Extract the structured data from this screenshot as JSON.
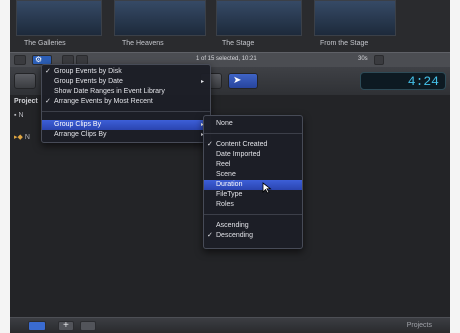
{
  "film_clips": [
    "The Galleries",
    "The Heavens",
    "The Stage",
    "From the Stage"
  ],
  "toolbar_top": {
    "selection_info": "1 of 15 selected, 10:21",
    "zoom": "30s"
  },
  "timecode": "4:24",
  "sidebar": {
    "heading": "Project",
    "row1": "N",
    "row2": "N"
  },
  "bottom": {
    "projects_label": "Projects"
  },
  "action_menu": {
    "items": [
      {
        "label": "Group Events by Disk",
        "checked": "✓"
      },
      {
        "label": "Group Events by Date",
        "checked": "",
        "submenu": "▸"
      },
      {
        "label": "Show Date Ranges in Event Library",
        "checked": ""
      },
      {
        "label": "Arrange Events by Most Recent",
        "checked": "✓"
      },
      {
        "label": "Group Clips By",
        "checked": "",
        "submenu": "▸"
      },
      {
        "label": "Arrange Clips By",
        "checked": "",
        "submenu": "▸"
      }
    ]
  },
  "group_clips_submenu": {
    "items": [
      {
        "label": "None",
        "checked": ""
      },
      {
        "label": "Content Created",
        "checked": "✓"
      },
      {
        "label": "Date Imported",
        "checked": ""
      },
      {
        "label": "Reel",
        "checked": ""
      },
      {
        "label": "Scene",
        "checked": ""
      },
      {
        "label": "Duration",
        "checked": ""
      },
      {
        "label": "FileType",
        "checked": ""
      },
      {
        "label": "Roles",
        "checked": ""
      },
      {
        "label": "Ascending",
        "checked": ""
      },
      {
        "label": "Descending",
        "checked": "✓"
      }
    ]
  },
  "colors": {
    "menu_highlight": "#3d5fd8",
    "timecode": "#44c0e8"
  }
}
